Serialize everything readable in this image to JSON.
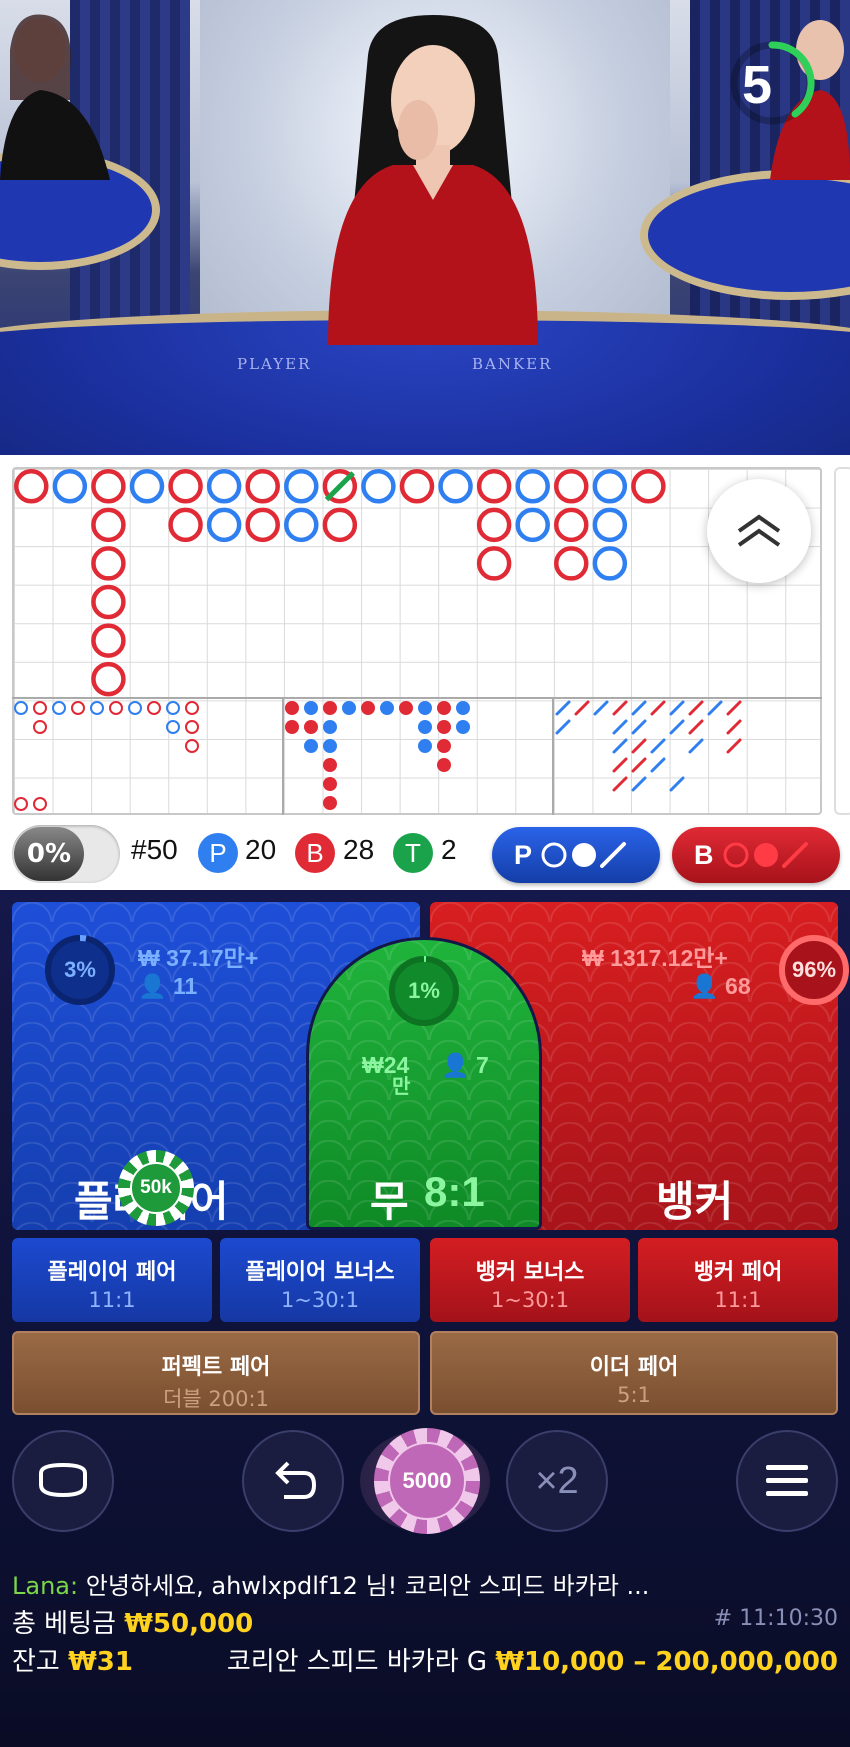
{
  "video": {
    "felt_player_label": "PLAYER",
    "felt_banker_label": "BANKER",
    "countdown": "5"
  },
  "stats": {
    "percent_toggle": "0%",
    "round_no": "#50",
    "player_badge": "P",
    "player_count": "20",
    "banker_badge": "B",
    "banker_count": "28",
    "tie_badge": "T",
    "tie_count": "2",
    "player_predict_label": "P",
    "banker_predict_label": "B"
  },
  "bets": {
    "player": {
      "label": "플레이어",
      "amount": "₩ 37.17만+",
      "users": "11",
      "percent": "3%",
      "percent_value": 0.03
    },
    "banker": {
      "label": "뱅커",
      "amount": "₩ 1317.12만+",
      "users": "68",
      "percent": "96%",
      "percent_value": 0.96
    },
    "tie": {
      "label": "무",
      "odds": "8:1",
      "amount_prefix": "₩",
      "amount_num": "24",
      "amount_unit": "만",
      "users": "7",
      "percent": "1%",
      "percent_value": 0.01
    },
    "placed_chip": "50k",
    "side": [
      {
        "title": "플레이어 페어",
        "odds": "11:1"
      },
      {
        "title": "플레이어 보너스",
        "odds": "1~30:1"
      },
      {
        "title": "뱅커 보너스",
        "odds": "1~30:1"
      },
      {
        "title": "뱅커 페어",
        "odds": "11:1"
      },
      {
        "title": "퍼펙트 페어",
        "odds": "더블 200:1"
      },
      {
        "title": "이더 페어",
        "odds": "5:1"
      }
    ]
  },
  "controls": {
    "chip_value": "5000",
    "double_label": "×2"
  },
  "footer": {
    "chat_user": "Lana:",
    "chat_message": "안녕하세요, ahwlxpdlf12 님! 코리안 스피드 바카라 ...",
    "total_bet_label": "총 베팅금",
    "total_bet_value": "₩50,000",
    "game_id": "# 11:10:30",
    "balance_label": "잔고",
    "balance_value": "₩31",
    "table_name": "코리안 스피드 바카라 G",
    "limits": "₩10,000 – 200,000,000"
  },
  "colors": {
    "player_blue": "#2f7ff0",
    "banker_red": "#e02a35",
    "tie_green": "#1aa34a",
    "accent_yellow": "#ffd21f"
  },
  "roadmap": {
    "big_road": [
      [
        "B"
      ],
      [
        "P"
      ],
      [
        "B",
        "B",
        "B",
        "B",
        "B",
        "B"
      ],
      [
        "P"
      ],
      [
        "B",
        "B"
      ],
      [
        "P",
        "P"
      ],
      [
        "B",
        "B"
      ],
      [
        "P",
        "P"
      ],
      [
        "B",
        "B"
      ],
      [
        "P"
      ],
      [
        "B"
      ],
      [
        "P"
      ],
      [
        "B",
        "B",
        "B"
      ],
      [
        "P",
        "P"
      ],
      [
        "B",
        "B",
        "B"
      ],
      [
        "P",
        "P",
        "P"
      ],
      [
        "B"
      ]
    ]
  }
}
